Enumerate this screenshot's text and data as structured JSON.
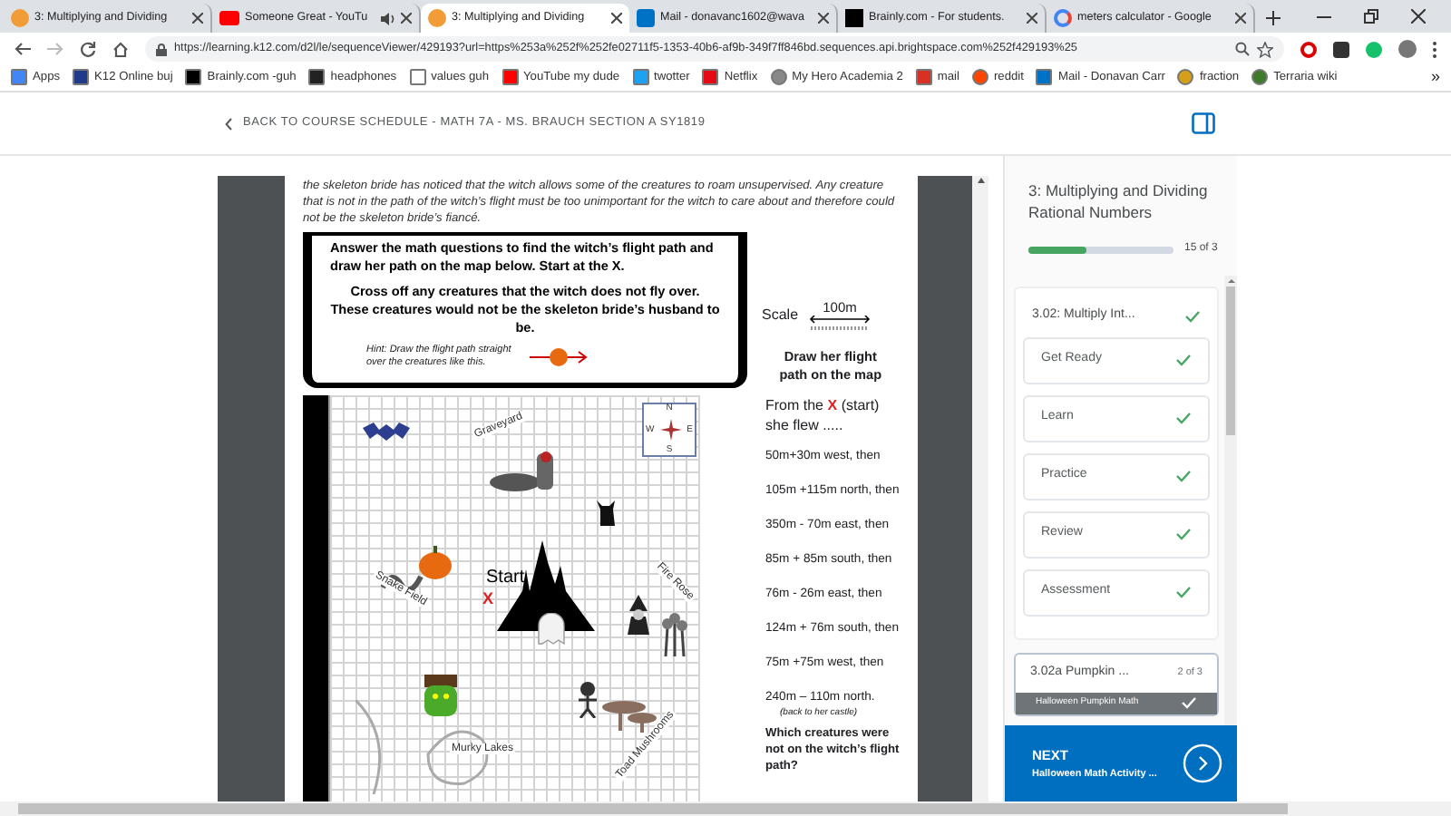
{
  "browser": {
    "tabs": [
      {
        "title": "3: Multiplying and Dividing",
        "selected": false,
        "kind": "site",
        "audio": false
      },
      {
        "title": "Someone Great - YouTu",
        "selected": false,
        "kind": "video",
        "audio": true
      },
      {
        "title": "3: Multiplying and Dividing",
        "selected": true,
        "kind": "site",
        "audio": false
      },
      {
        "title": "Mail - donavanc1602@wava",
        "selected": false,
        "kind": "mail",
        "audio": false
      },
      {
        "title": "Brainly.com - For students.",
        "selected": false,
        "kind": "brainly",
        "audio": false
      },
      {
        "title": "meters calculator - Google",
        "selected": false,
        "kind": "google",
        "audio": false
      }
    ],
    "url": "https://learning.k12.com/d2l/le/sequenceViewer/429193?url=https%253a%252f%252fe02711f5-1353-40b6-af9b-349f7ff846bd.sequences.api.brightspace.com%252f429193%25",
    "bookmarks": [
      {
        "label": "Apps",
        "kind": "apps"
      },
      {
        "label": "K12 Online buj",
        "kind": "k12"
      },
      {
        "label": "Brainly.com -guh",
        "kind": "brainly"
      },
      {
        "label": "headphones",
        "kind": "amazon"
      },
      {
        "label": "values guh",
        "kind": "page"
      },
      {
        "label": "YouTube my dude",
        "kind": "video"
      },
      {
        "label": "twotter",
        "kind": "bird"
      },
      {
        "label": "Netflix",
        "kind": "netflix"
      },
      {
        "label": "My Hero Academia 2",
        "kind": "globe"
      },
      {
        "label": "mail",
        "kind": "mail"
      },
      {
        "label": "reddit",
        "kind": "reddit"
      },
      {
        "label": "Mail - Donavan Carr",
        "kind": "outlook"
      },
      {
        "label": "fraction",
        "kind": "trophy"
      },
      {
        "label": "Terraria wiki",
        "kind": "tree"
      }
    ],
    "more_bookmarks": "»"
  },
  "page": {
    "back_link": "BACK TO COURSE SCHEDULE - MATH 7A - MS. BRAUCH SECTION A SY1819",
    "worksheet": {
      "intro": "the skeleton bride has noticed that the witch allows some of the creatures to roam unsupervised. Any creature that is not in the path of the witch’s flight must be too unimportant for the witch to care about and therefore could not be the skeleton bride’s fiancé.",
      "instruction_1": "Answer the math questions to find the witch’s flight path and draw her path on the map below. Start at the X.",
      "instruction_2": "Cross off any creatures that the witch does not fly over. These creatures would not be the skeleton bride’s husband to be.",
      "hint": "Hint: Draw the flight path straight over the creatures like this.",
      "scale_label": "Scale",
      "scale_value": "100m",
      "map_labels": [
        "Graveyard",
        "Snake Field",
        "Start",
        "Fire Rose",
        "Murky Lakes",
        "Toad Mushrooms"
      ],
      "start_mark": "X",
      "compass": {
        "n": "N",
        "e": "E",
        "s": "S",
        "w": "W"
      },
      "path_heading": "Draw her flight path on the map",
      "from_text": "From the",
      "from_mark": "X",
      "from_after": "(start)",
      "flew": "she flew .....",
      "steps": [
        "50m+30m west, then",
        "105m +115m north, then",
        "350m - 70m east, then",
        "85m + 85m south, then",
        "76m - 26m east, then",
        "124m + 76m south, then",
        "75m +75m west, then",
        "240m – 110m north."
      ],
      "step_note": "(back to her castle)",
      "question": "Which creatures were not on the witch’s flight path?"
    }
  },
  "sidebar": {
    "title": "3: Multiplying and Dividing Rational Numbers",
    "level": 0.4,
    "progress_text": "15 of 3",
    "section": {
      "title": "3.02: Multiply Int...",
      "done": true,
      "items": [
        {
          "label": "Get Ready",
          "done": true
        },
        {
          "label": "Learn",
          "done": true
        },
        {
          "label": "Practice",
          "done": true
        },
        {
          "label": "Review",
          "done": true
        },
        {
          "label": "Assessment",
          "done": true
        }
      ]
    },
    "section_2": {
      "title": "3.02a Pumpkin ...",
      "count": "2 of 3",
      "items": [
        {
          "label": "Halloween Pumpkin Math",
          "done": true,
          "selected": true
        }
      ]
    },
    "next": {
      "label": "NEXT",
      "subtitle": "Halloween Math Activity ..."
    }
  }
}
